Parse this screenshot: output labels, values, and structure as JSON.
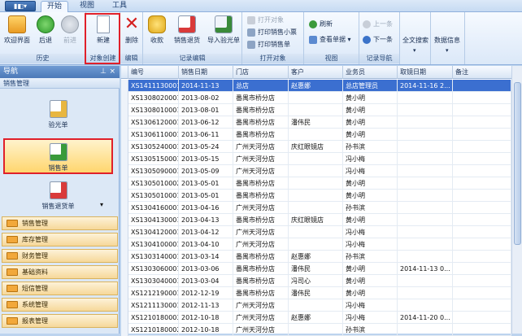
{
  "app": {
    "menu_button": "▮◧▾"
  },
  "tabs": [
    {
      "label": "开始"
    },
    {
      "label": "视图"
    },
    {
      "label": "工具"
    }
  ],
  "ribbon": {
    "groups": [
      {
        "label": "历史",
        "buttons": [
          "欢迎界面",
          "后退",
          "前进"
        ]
      },
      {
        "label": "对象创建",
        "buttons": [
          "新建"
        ]
      },
      {
        "label": "编辑",
        "buttons": [
          "删除"
        ]
      },
      {
        "label": "记录编辑",
        "buttons": [
          "收款",
          "销售退货",
          "导入验光单"
        ]
      },
      {
        "label": "打开对象",
        "buttons": [
          "打开对象",
          "打印销售小票",
          "打印销售单"
        ]
      },
      {
        "label": "视图",
        "buttons": [
          "刷新",
          "查看单据"
        ]
      },
      {
        "label": "记录导航",
        "buttons": [
          "上一条",
          "下一条"
        ]
      },
      {
        "label": "",
        "buttons": [
          "全文搜索"
        ]
      },
      {
        "label": "",
        "buttons": [
          "数据信息"
        ]
      }
    ]
  },
  "nav": {
    "title": "导航",
    "pin": "⊥",
    "close": "×",
    "section": "销售管理",
    "big_items": [
      "验光单",
      "销售单",
      "销售退货单"
    ],
    "categories": [
      "销售管理",
      "库存管理",
      "财务管理",
      "基础资料",
      "短信管理",
      "系统管理",
      "报表管理"
    ]
  },
  "grid": {
    "columns": [
      "编号",
      "销售日期",
      "门店",
      "客户",
      "业务员",
      "取镜日期",
      "备注"
    ],
    "rows": [
      [
        "XS1411130001",
        "2014-11-13",
        "总店",
        "赵惠娜",
        "总店管理员",
        "2014-11-16 2...",
        ""
      ],
      [
        "XS1308020001",
        "2013-08-02",
        "番禺市桥分店",
        "",
        "黄小明",
        "",
        ""
      ],
      [
        "XS1308010001",
        "2013-08-01",
        "番禺市桥分店",
        "",
        "黄小明",
        "",
        ""
      ],
      [
        "XS1306120001",
        "2013-06-12",
        "番禺市桥分店",
        "潘伟民",
        "黄小明",
        "",
        ""
      ],
      [
        "XS1306110001",
        "2013-06-11",
        "番禺市桥分店",
        "",
        "黄小明",
        "",
        ""
      ],
      [
        "XS1305240001",
        "2013-05-24",
        "广州天河分店",
        "庆红眼镜店",
        "孙书滨",
        "",
        ""
      ],
      [
        "XS1305150001",
        "2013-05-15",
        "广州天河分店",
        "",
        "冯小梅",
        "",
        ""
      ],
      [
        "XS1305090001",
        "2013-05-09",
        "广州天河分店",
        "",
        "冯小梅",
        "",
        ""
      ],
      [
        "XS1305010002",
        "2013-05-01",
        "番禺市桥分店",
        "",
        "黄小明",
        "",
        ""
      ],
      [
        "XS1305010001",
        "2013-05-01",
        "番禺市桥分店",
        "",
        "黄小明",
        "",
        ""
      ],
      [
        "XS1304160001",
        "2013-04-16",
        "广州天河分店",
        "",
        "孙书滨",
        "",
        ""
      ],
      [
        "XS1304130001",
        "2013-04-13",
        "番禺市桥分店",
        "庆红眼镜店",
        "黄小明",
        "",
        ""
      ],
      [
        "XS1304120001",
        "2013-04-12",
        "广州天河分店",
        "",
        "冯小梅",
        "",
        ""
      ],
      [
        "XS1304100001",
        "2013-04-10",
        "广州天河分店",
        "",
        "冯小梅",
        "",
        ""
      ],
      [
        "XS1303140001",
        "2013-03-14",
        "番禺市桥分店",
        "赵惠娜",
        "孙书滨",
        "",
        ""
      ],
      [
        "XS1303060001",
        "2013-03-06",
        "番禺市桥分店",
        "潘伟民",
        "黄小明",
        "2014-11-13 0...",
        ""
      ],
      [
        "XS1303040001",
        "2013-03-04",
        "番禺市桥分店",
        "冯司心",
        "黄小明",
        "",
        ""
      ],
      [
        "XS1212190001",
        "2012-12-19",
        "番禺市桥分店",
        "潘伟民",
        "黄小明",
        "",
        ""
      ],
      [
        "XS1211130001",
        "2012-11-13",
        "广州天河分店",
        "",
        "冯小梅",
        "",
        ""
      ],
      [
        "XS1210180003",
        "2012-10-18",
        "广州天河分店",
        "赵惠娜",
        "冯小梅",
        "2014-11-20 0...",
        ""
      ],
      [
        "XS1210180002",
        "2012-10-18",
        "广州天河分店",
        "",
        "孙书滨",
        "",
        ""
      ]
    ]
  },
  "colors": {
    "selected_row": "#3b6fd0",
    "highlight_border": "#e0202a",
    "nav_category": "#f6d89a"
  }
}
